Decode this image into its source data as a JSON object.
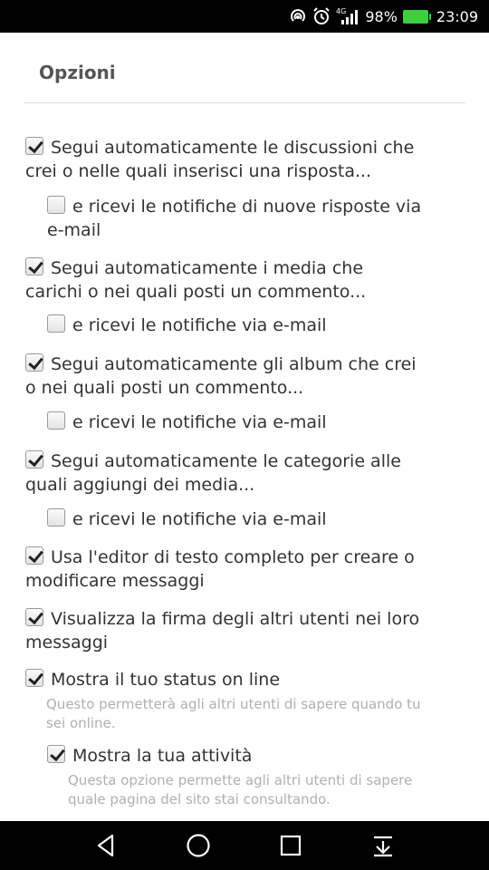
{
  "status_bar": {
    "battery_percent": "98%",
    "time": "23:09",
    "network_label": "4G",
    "icons": [
      "hotspot-icon",
      "alarm-icon",
      "signal-icon",
      "battery-icon"
    ]
  },
  "options_panel": {
    "title": "Opzioni",
    "options": [
      {
        "label_l1": "Segui automaticamente le discussioni che",
        "label_l2": "crei o nelle quali inserisci una risposta...",
        "checked": true
      },
      {
        "label_l1": "e ricevi le notifiche di nuove risposte via",
        "label_l2": "e-mail",
        "checked": false
      },
      {
        "label_l1": "Segui automaticamente i media che",
        "label_l2": "carichi o nei quali posti un commento...",
        "checked": true
      },
      {
        "label_l1": "e ricevi le notifiche via e-mail",
        "checked": false
      },
      {
        "label_l1": "Segui automaticamente gli album che crei",
        "label_l2": "o nei quali posti un commento...",
        "checked": true
      },
      {
        "label_l1": "e ricevi le notifiche via e-mail",
        "checked": false
      },
      {
        "label_l1": "Segui automaticamente le categorie alle",
        "label_l2": "quali aggiungi dei media...",
        "checked": true
      },
      {
        "label_l1": "e ricevi le notifiche via e-mail",
        "checked": false
      },
      {
        "label_l1": "Usa l'editor di testo completo per creare o",
        "label_l2": "modificare messaggi",
        "checked": true
      },
      {
        "label_l1": "Visualizza la firma degli altri utenti nei loro",
        "label_l2": "messaggi",
        "checked": true
      },
      {
        "label_l1": "Mostra il tuo status on line",
        "checked": true,
        "hint_l1": "Questo permetterà agli altri utenti di sapere quando tu",
        "hint_l2": "sei online."
      },
      {
        "label_l1": "Mostra la tua attività",
        "checked": true,
        "hint_l1": "Questa opzione permette agli altri utenti di sapere",
        "hint_l2": "quale pagina del sito stai consultando."
      }
    ]
  },
  "nav_bar": {
    "buttons": [
      "back-icon",
      "home-icon",
      "recents-icon",
      "notifications-pulldown-icon"
    ]
  },
  "colors": {
    "battery": "#3ecf3e",
    "title": "#555555",
    "text": "#333333",
    "hint": "#b0b0b0"
  }
}
